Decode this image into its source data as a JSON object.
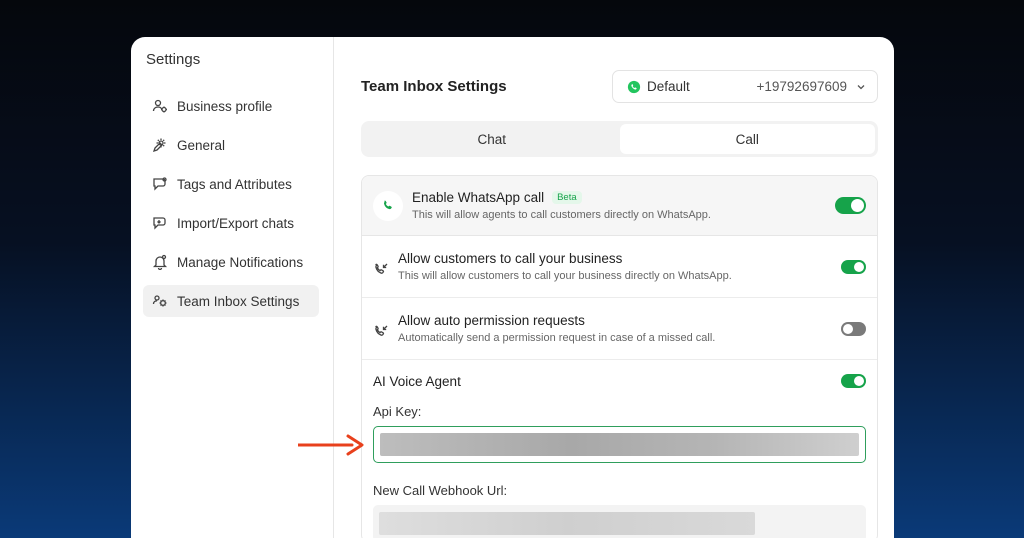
{
  "sidebar": {
    "title": "Settings",
    "items": [
      {
        "label": "Business profile",
        "icon": "users-gear-icon"
      },
      {
        "label": "General",
        "icon": "gear-pencil-icon"
      },
      {
        "label": "Tags and Attributes",
        "icon": "tag-chat-icon"
      },
      {
        "label": "Import/Export chats",
        "icon": "chat-export-icon"
      },
      {
        "label": "Manage Notifications",
        "icon": "bell-icon"
      },
      {
        "label": "Team Inbox Settings",
        "icon": "inbox-gear-icon",
        "active": true
      }
    ]
  },
  "header": {
    "title": "Team Inbox Settings",
    "account_label": "Default",
    "account_number": "+19792697609"
  },
  "tabs": [
    {
      "label": "Chat",
      "active": false
    },
    {
      "label": "Call",
      "active": true
    }
  ],
  "settings": {
    "enable_call": {
      "title": "Enable WhatsApp call",
      "badge": "Beta",
      "desc": "This will allow agents to call customers directly on WhatsApp.",
      "enabled": true
    },
    "allow_customers": {
      "title": "Allow customers to call your business",
      "desc": "This will allow customers to call your business directly on WhatsApp.",
      "enabled": true
    },
    "auto_permission": {
      "title": "Allow auto permission requests",
      "desc": "Automatically send a permission request in case of a missed call.",
      "enabled": false
    },
    "ai_voice_agent": {
      "title": "AI Voice Agent",
      "enabled": true,
      "api_key_label": "Api Key:",
      "webhook_label": "New Call Webhook Url:"
    }
  },
  "colors": {
    "accent_green": "#16a34a",
    "arrow_red": "#e8401c"
  }
}
